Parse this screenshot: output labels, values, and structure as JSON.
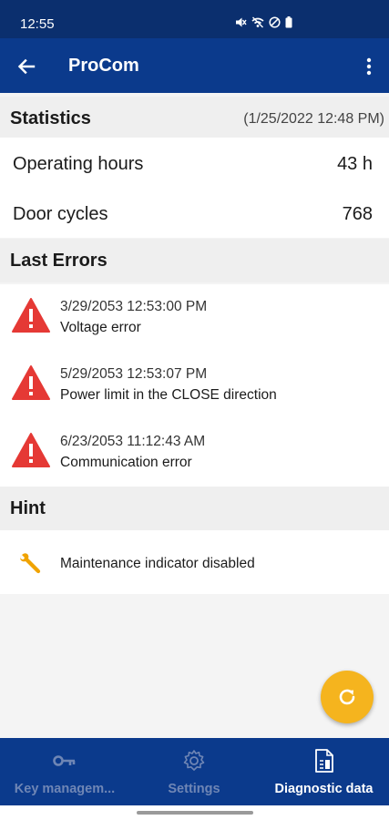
{
  "status_bar": {
    "time": "12:55"
  },
  "app_bar": {
    "title": "ProCom"
  },
  "statistics": {
    "title": "Statistics",
    "date": "(1/25/2022 12:48 PM)",
    "rows": [
      {
        "label": "Operating hours",
        "value": "43 h"
      },
      {
        "label": "Door cycles",
        "value": "768"
      }
    ]
  },
  "last_errors": {
    "title": "Last Errors",
    "items": [
      {
        "time": "3/29/2053 12:53:00 PM",
        "message": "Voltage error"
      },
      {
        "time": "5/29/2053 12:53:07 PM",
        "message": "Power limit in the CLOSE direction"
      },
      {
        "time": "6/23/2053 11:12:43 AM",
        "message": "Communication error"
      }
    ]
  },
  "hint": {
    "title": "Hint",
    "text": "Maintenance indicator disabled",
    "icon": "wrench-icon"
  },
  "fab": {
    "icon": "refresh-icon"
  },
  "bottom_nav": {
    "items": [
      {
        "label": "Key managem...",
        "icon": "key-icon",
        "active": false
      },
      {
        "label": "Settings",
        "icon": "gear-icon",
        "active": false
      },
      {
        "label": "Diagnostic data",
        "icon": "diagnostic-icon",
        "active": true
      }
    ]
  },
  "colors": {
    "app_bar": "#0b3a8c",
    "status_bar": "#0b2f6e",
    "error_red": "#e53935",
    "accent_yellow": "#f5b41e",
    "wrench_orange": "#f0a300"
  }
}
